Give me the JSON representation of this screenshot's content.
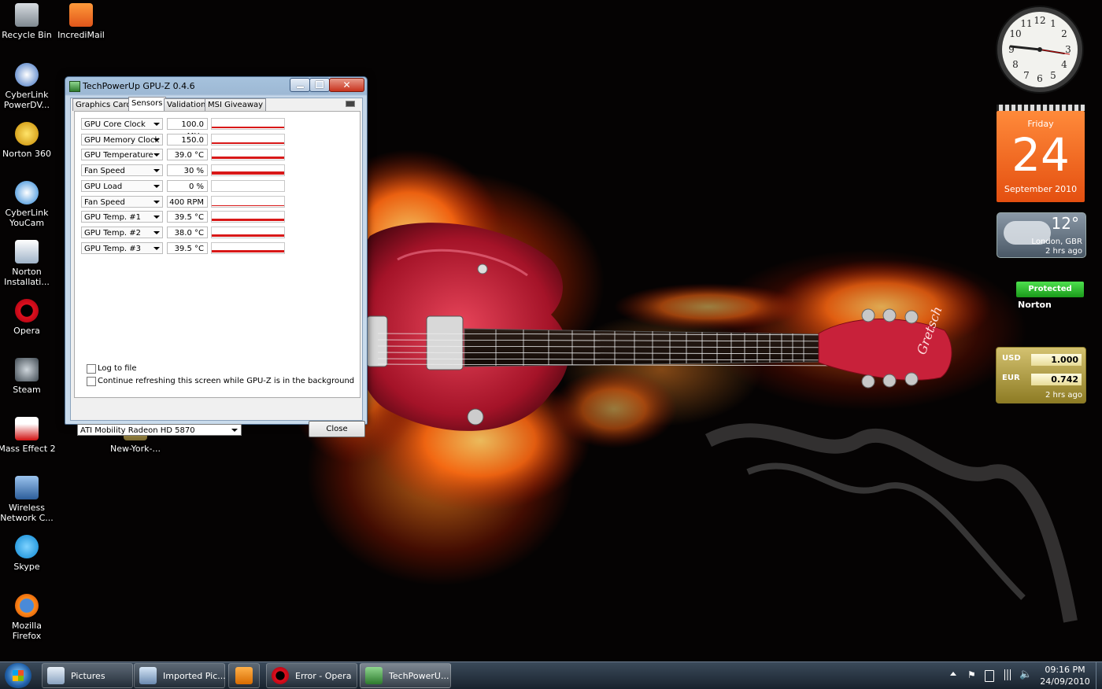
{
  "desktop": {
    "icons": [
      {
        "label": "Recycle Bin"
      },
      {
        "label": "IncrediMail"
      },
      {
        "label": "CyberLink PowerDV..."
      },
      {
        "label": "Norton 360"
      },
      {
        "label": "CyberLink YouCam"
      },
      {
        "label": "Norton Installati..."
      },
      {
        "label": "Opera"
      },
      {
        "label": "Steam"
      },
      {
        "label": "Mass Effect 2"
      },
      {
        "label": "New-York-..."
      },
      {
        "label": "Wireless Network C..."
      },
      {
        "label": "Skype"
      },
      {
        "label": "Mozilla Firefox"
      }
    ],
    "wallpaper_logo": "Gretsch"
  },
  "gadgets": {
    "clock": {
      "numbers": [
        "12",
        "1",
        "2",
        "3",
        "4",
        "5",
        "6",
        "7",
        "8",
        "9",
        "10",
        "11"
      ]
    },
    "calendar": {
      "day_name": "Friday",
      "day": "24",
      "month_year": "September 2010"
    },
    "weather": {
      "temp": "12°",
      "location": "London, GBR",
      "updated": "2 hrs ago"
    },
    "norton": {
      "status": "Protected",
      "brand": "Norton"
    },
    "currency": {
      "from_code": "USD",
      "from_value": "1.000",
      "to_code": "EUR",
      "to_value": "0.742",
      "updated": "2 hrs ago"
    }
  },
  "window": {
    "title": "TechPowerUp GPU-Z 0.4.6",
    "tabs": [
      "Graphics Card",
      "Sensors",
      "Validation",
      "MSI Giveaway"
    ],
    "active_tab": "Sensors",
    "sensors": [
      {
        "name": "GPU Core Clock",
        "value": "100.0 MHz",
        "level": 0.15
      },
      {
        "name": "GPU Memory Clock",
        "value": "150.0 MHz",
        "level": 0.15
      },
      {
        "name": "GPU Temperature",
        "value": "39.0 °C",
        "level": 0.25
      },
      {
        "name": "Fan Speed",
        "value": "30 %",
        "level": 0.3
      },
      {
        "name": "GPU Load",
        "value": "0 %",
        "level": 0
      },
      {
        "name": "Fan Speed",
        "value": "400 RPM",
        "level": 0.1
      },
      {
        "name": "GPU Temp. #1",
        "value": "39.5 °C",
        "level": 0.2
      },
      {
        "name": "GPU Temp. #2",
        "value": "38.0 °C",
        "level": 0.2
      },
      {
        "name": "GPU Temp. #3",
        "value": "39.5 °C",
        "level": 0.2
      }
    ],
    "log_to_file_label": "Log to file",
    "continue_refresh_label": "Continue refreshing this screen while GPU-Z is in the background",
    "gpu_select": "ATI Mobility Radeon HD 5870",
    "close_label": "Close"
  },
  "taskbar": {
    "buttons": [
      {
        "label": "Pictures"
      },
      {
        "label": "Imported Pic..."
      },
      {
        "label": "Error - Opera"
      },
      {
        "label": "TechPowerU..."
      }
    ],
    "time": "09:16 PM",
    "date": "24/09/2010"
  }
}
